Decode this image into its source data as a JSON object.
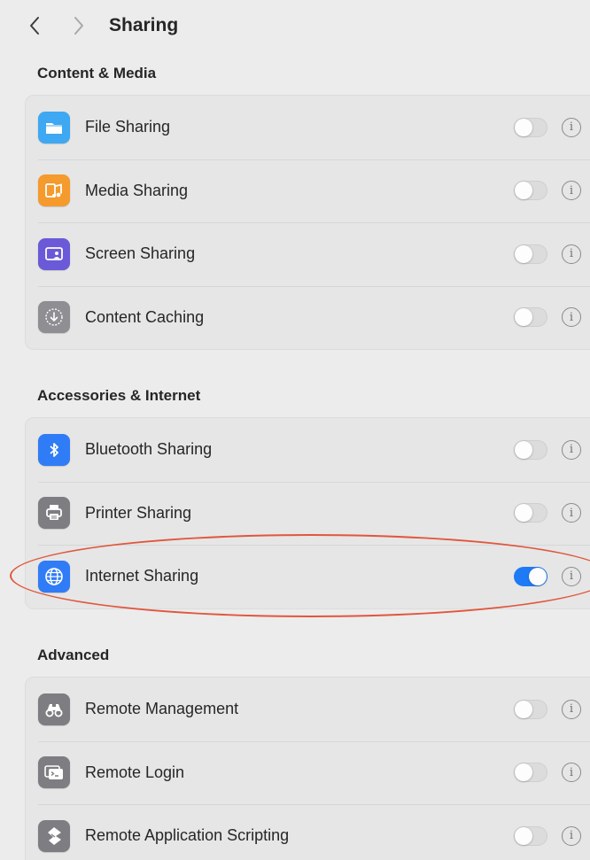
{
  "header": {
    "back_icon": "chevron-left-icon",
    "forward_icon": "chevron-right-icon",
    "title": "Sharing"
  },
  "sections": [
    {
      "title": "Content & Media",
      "items": [
        {
          "label": "File Sharing",
          "icon": "folder-icon",
          "icon_color": "#3ea8f2",
          "enabled": false
        },
        {
          "label": "Media Sharing",
          "icon": "music-icon",
          "icon_color": "#f59a2c",
          "enabled": false
        },
        {
          "label": "Screen Sharing",
          "icon": "screen-share-icon",
          "icon_color": "#6a5ad8",
          "enabled": false
        },
        {
          "label": "Content Caching",
          "icon": "download-circle-icon",
          "icon_color": "#8e8e93",
          "enabled": false
        }
      ]
    },
    {
      "title": "Accessories & Internet",
      "items": [
        {
          "label": "Bluetooth Sharing",
          "icon": "bluetooth-icon",
          "icon_color": "#2f7cf6",
          "enabled": false
        },
        {
          "label": "Printer Sharing",
          "icon": "printer-icon",
          "icon_color": "#7d7d82",
          "enabled": false
        },
        {
          "label": "Internet Sharing",
          "icon": "globe-icon",
          "icon_color": "#2f7cf6",
          "enabled": true
        }
      ]
    },
    {
      "title": "Advanced",
      "items": [
        {
          "label": "Remote Management",
          "icon": "binoculars-icon",
          "icon_color": "#7d7d82",
          "enabled": false
        },
        {
          "label": "Remote Login",
          "icon": "terminal-icon",
          "icon_color": "#7d7d82",
          "enabled": false
        },
        {
          "label": "Remote Application Scripting",
          "icon": "script-icon",
          "icon_color": "#7d7d82",
          "enabled": false
        }
      ]
    }
  ],
  "info_glyph": "i",
  "colors": {
    "toggle_on": "#1f7af5",
    "toggle_off": "#dcdcdc",
    "highlight_annotation": "#e0573d"
  }
}
